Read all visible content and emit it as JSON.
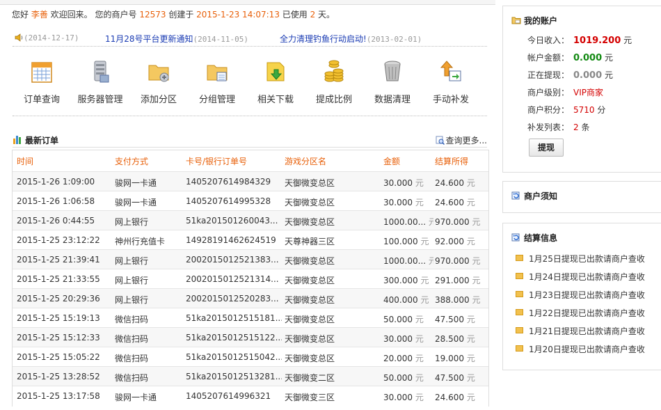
{
  "welcome": {
    "greet": "您好",
    "user": "李善",
    "text1": " 欢迎回来。 您的商户号 ",
    "merchant_id": "12573",
    "text2": " 创建于 ",
    "created": "2015-1-23 14:07:13",
    "text3": " 已使用 ",
    "days": "2",
    "text4": " 天。"
  },
  "notices": [
    {
      "title": "",
      "date": "(2014-12-17)"
    },
    {
      "title": "11月28号平台更新通知",
      "date": "(2014-11-05)"
    },
    {
      "title": "全力清理钓鱼行动启动!",
      "date": "(2013-02-01)"
    }
  ],
  "toolbar": [
    {
      "label": "订单查询",
      "icon": "calendar-icon"
    },
    {
      "label": "服务器管理",
      "icon": "server-icon"
    },
    {
      "label": "添加分区",
      "icon": "folder-add-icon"
    },
    {
      "label": "分组管理",
      "icon": "folder-group-icon"
    },
    {
      "label": "相关下载",
      "icon": "download-icon"
    },
    {
      "label": "提成比例",
      "icon": "coins-icon"
    },
    {
      "label": "数据清理",
      "icon": "trash-icon"
    },
    {
      "label": "手动补发",
      "icon": "resend-icon"
    }
  ],
  "orders": {
    "title": "最新订单",
    "more": "查询更多...",
    "headers": [
      "时间",
      "支付方式",
      "卡号/银行订单号",
      "游戏分区名",
      "金额",
      "结算所得"
    ],
    "currency": "元",
    "rows": [
      [
        "2015-1-26 1:09:00",
        "骏网一卡通",
        "1405207614984329",
        "天御微变总区",
        "30.000",
        "24.600"
      ],
      [
        "2015-1-26 1:06:58",
        "骏网一卡通",
        "1405207614995328",
        "天御微变总区",
        "30.000",
        "24.600"
      ],
      [
        "2015-1-26 0:44:55",
        "网上银行",
        "51ka201501260043...",
        "天御微变总区",
        "1000.00...",
        "970.000"
      ],
      [
        "2015-1-25 23:12:22",
        "神州行充值卡",
        "14928191462624519",
        "天尊神器三区",
        "100.000",
        "92.000"
      ],
      [
        "2015-1-25 21:39:41",
        "网上银行",
        "2002015012521383...",
        "天御微变总区",
        "1000.00...",
        "970.000"
      ],
      [
        "2015-1-25 21:33:55",
        "网上银行",
        "2002015012521314...",
        "天御微变总区",
        "300.000",
        "291.000"
      ],
      [
        "2015-1-25 20:29:36",
        "网上银行",
        "2002015012520283...",
        "天御微变总区",
        "400.000",
        "388.000"
      ],
      [
        "2015-1-25 15:19:13",
        "微信扫码",
        "51ka2015012515181...",
        "天御微变总区",
        "50.000",
        "47.500"
      ],
      [
        "2015-1-25 15:12:33",
        "微信扫码",
        "51ka2015012515122...",
        "天御微变总区",
        "30.000",
        "28.500"
      ],
      [
        "2015-1-25 15:05:22",
        "微信扫码",
        "51ka2015012515042...",
        "天御微变总区",
        "20.000",
        "19.000"
      ],
      [
        "2015-1-25 13:28:52",
        "微信扫码",
        "51ka2015012513281...",
        "天御微变二区",
        "50.000",
        "47.500"
      ],
      [
        "2015-1-25 13:17:58",
        "骏网一卡通",
        "1405207614996321",
        "天御微变三区",
        "30.000",
        "24.600"
      ]
    ]
  },
  "account": {
    "title": "我的账户",
    "rows": [
      {
        "label": "今日收入：",
        "value": "1019.200",
        "unit": " 元"
      },
      {
        "label": "帐户金额：",
        "value": "0.000",
        "unit": " 元"
      },
      {
        "label": "正在提现：",
        "value": "0.000",
        "unit": " 元"
      },
      {
        "label": "商户级别：",
        "value": "VIP商家",
        "unit": ""
      },
      {
        "label": "商户积分：",
        "value": "5710",
        "unit": " 分"
      },
      {
        "label": "补发列表：",
        "value": "2",
        "unit": " 条"
      }
    ],
    "withdraw": "提现"
  },
  "notice_panel": {
    "title": "商户须知"
  },
  "settle": {
    "title": "结算信息",
    "items": [
      "1月25日提现已出款请商户查收",
      "1月24日提现已出款请商户查收",
      "1月23日提现已出款请商户查收",
      "1月22日提现已出款请商户查收",
      "1月21日提现已出款请商户查收",
      "1月20日提现已出款请商户查收"
    ]
  },
  "colors": {
    "accent": "#e8600a",
    "link": "#1a3bb3",
    "income": "#d40000",
    "balance": "#138a13"
  }
}
